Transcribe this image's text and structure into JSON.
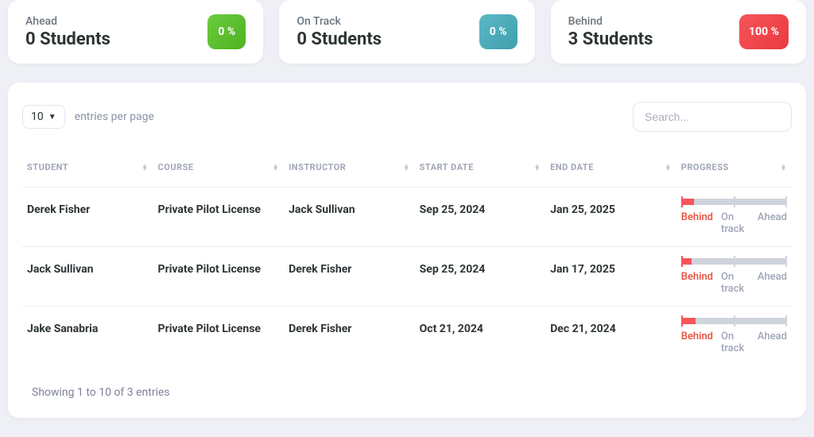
{
  "cards": [
    {
      "label": "Ahead",
      "value": "0 Students",
      "pct": "0 %",
      "badge": "green"
    },
    {
      "label": "On Track",
      "value": "0 Students",
      "pct": "0 %",
      "badge": "teal"
    },
    {
      "label": "Behind",
      "value": "3 Students",
      "pct": "100 %",
      "badge": "red"
    }
  ],
  "pagesize": {
    "value": "10",
    "label": "entries per page"
  },
  "search": {
    "placeholder": "Search..."
  },
  "columns": [
    "Student",
    "Course",
    "Instructor",
    "Start Date",
    "End Date",
    "Progress"
  ],
  "progress_labels": {
    "behind": "Behind",
    "ontrack": "On track",
    "ahead": "Ahead"
  },
  "rows": [
    {
      "student": "Derek Fisher",
      "course": "Private Pilot License",
      "instructor": "Jack Sullivan",
      "start": "Sep 25, 2024",
      "end": "Jan 25, 2025",
      "progress_pct": 12
    },
    {
      "student": "Jack Sullivan",
      "course": "Private Pilot License",
      "instructor": "Derek Fisher",
      "start": "Sep 25, 2024",
      "end": "Jan 17, 2025",
      "progress_pct": 10
    },
    {
      "student": "Jake Sanabria",
      "course": "Private Pilot License",
      "instructor": "Derek Fisher",
      "start": "Oct 21, 2024",
      "end": "Dec 21, 2024",
      "progress_pct": 14
    }
  ],
  "footer": "Showing 1 to 10 of 3 entries"
}
